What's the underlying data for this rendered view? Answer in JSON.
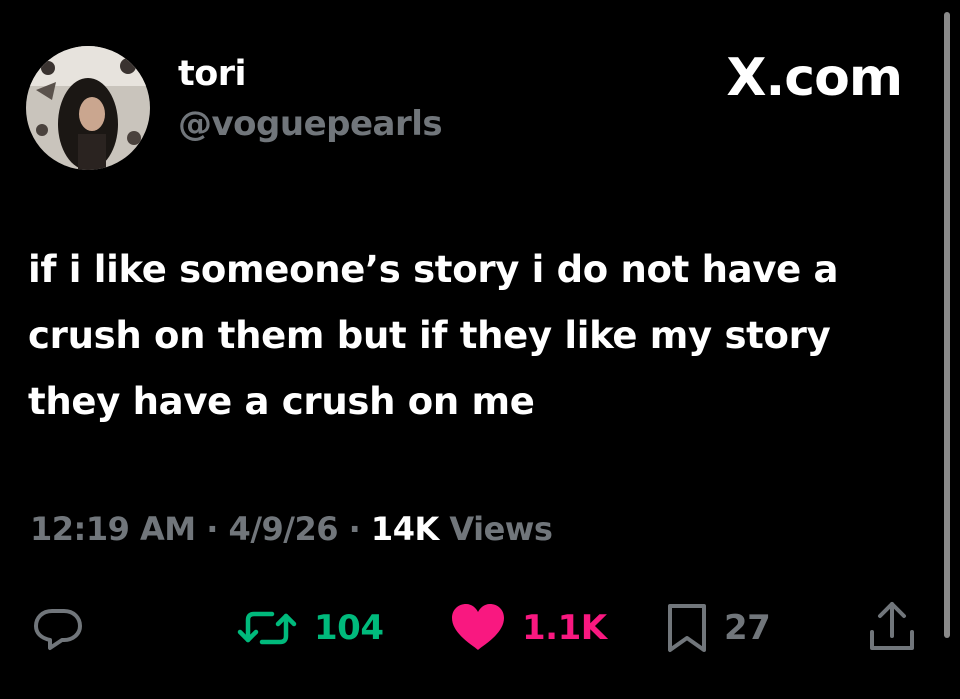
{
  "user": {
    "display_name": "tori",
    "handle": "@voguepearls",
    "avatar": "profile-photo"
  },
  "brand": "X.com",
  "tweet": {
    "text": "if i like someone’s story i do not have a crush on them but if they like my story they have a crush on me"
  },
  "meta": {
    "time": "12:19 AM",
    "separator": "·",
    "date": "4/9/26",
    "views_count": "14K",
    "views_label": "Views"
  },
  "actions": {
    "reply_icon": "reply-bubble-icon",
    "retweet_icon": "retweet-icon",
    "retweets": "104",
    "like_icon": "heart-filled-icon",
    "likes": "1.1K",
    "bookmark_icon": "bookmark-icon",
    "bookmarks": "27",
    "share_icon": "share-icon"
  },
  "colors": {
    "background": "#000000",
    "text": "#ffffff",
    "secondary": "#71767b",
    "retweet": "#00ba7c",
    "like": "#f91880"
  }
}
